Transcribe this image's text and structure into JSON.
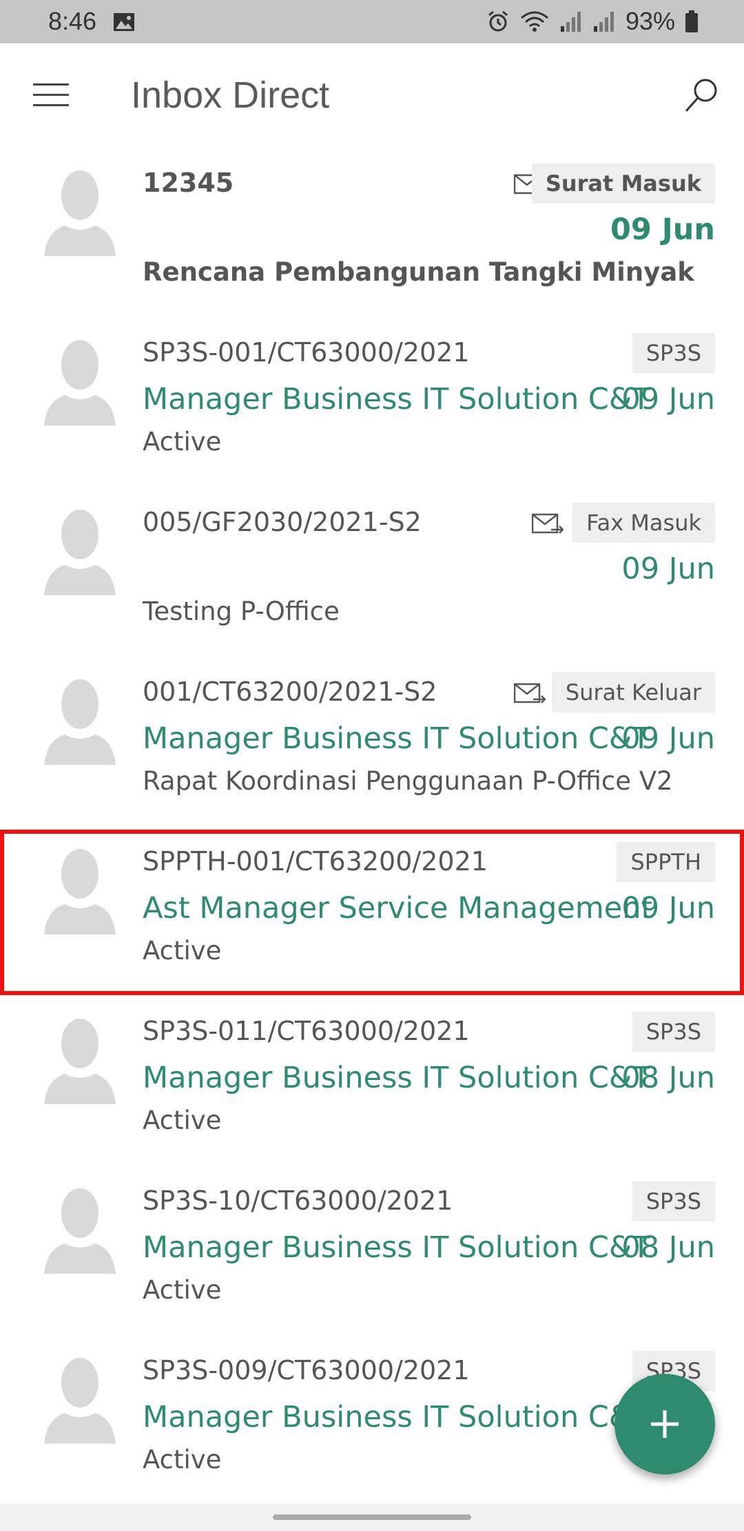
{
  "status_bar": {
    "time": "8:46",
    "battery": "93%",
    "icons": [
      "image-icon",
      "alarm-icon",
      "wifi-icon",
      "signal-icon",
      "signal-icon",
      "battery-icon"
    ]
  },
  "app_bar": {
    "title": "Inbox Direct",
    "menu_icon": "hamburger-icon",
    "search_icon": "search-icon"
  },
  "items": [
    {
      "ref": "12345",
      "badge": "Surat Masuk",
      "date": "09 Jun",
      "sender": "",
      "subject": "Rencana Pembangunan Tangki Minyak",
      "unread": true,
      "has_mail_icon": true
    },
    {
      "ref": "SP3S-001/CT63000/2021",
      "badge": "SP3S",
      "date": "09 Jun",
      "sender": "Manager Business IT Solution C&T",
      "subject": "Active",
      "unread": false,
      "has_mail_icon": false
    },
    {
      "ref": "005/GF2030/2021-S2",
      "badge": "Fax Masuk",
      "date": "09 Jun",
      "sender": "",
      "subject": "Testing P-Office",
      "unread": false,
      "has_mail_icon": true
    },
    {
      "ref": "001/CT63200/2021-S2",
      "badge": "Surat Keluar",
      "date": "09 Jun",
      "sender": "Manager Business IT Solution C&T",
      "subject": "Rapat Koordinasi Penggunaan P-Office V2",
      "unread": false,
      "has_mail_icon": true
    },
    {
      "ref": "SPPTH-001/CT63200/2021",
      "badge": "SPPTH",
      "date": "09 Jun",
      "sender": "Ast Manager Service Management",
      "subject": "Active",
      "unread": false,
      "has_mail_icon": false,
      "highlighted": true
    },
    {
      "ref": "SP3S-011/CT63000/2021",
      "badge": "SP3S",
      "date": "08 Jun",
      "sender": "Manager Business IT Solution C&T",
      "subject": "Active",
      "unread": false,
      "has_mail_icon": false
    },
    {
      "ref": "SP3S-10/CT63000/2021",
      "badge": "SP3S",
      "date": "08 Jun",
      "sender": "Manager Business IT Solution C&T",
      "subject": "Active",
      "unread": false,
      "has_mail_icon": false
    },
    {
      "ref": "SP3S-009/CT63000/2021",
      "badge": "SP3S",
      "date": "",
      "sender": "Manager Business IT Solution C&T",
      "subject": "Active",
      "unread": false,
      "has_mail_icon": false
    }
  ],
  "fab": {
    "icon": "plus-icon"
  },
  "colors": {
    "accent": "#2e8b6d",
    "highlight": "#ee1111",
    "status_bar": "#c6c6c6"
  }
}
